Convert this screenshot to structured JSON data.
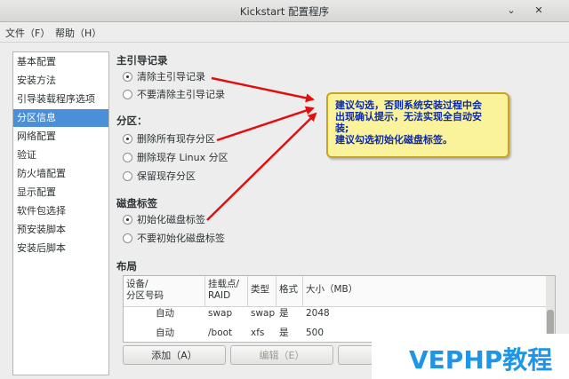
{
  "window": {
    "title": "Kickstart 配置程序",
    "minimize_glyph": "⌄",
    "close_glyph": "✕"
  },
  "menu": {
    "file": "文件（F）",
    "help": "帮助（H）"
  },
  "sidebar": {
    "items": [
      {
        "label": "基本配置"
      },
      {
        "label": "安装方法"
      },
      {
        "label": "引导装载程序选项"
      },
      {
        "label": "分区信息",
        "active": true
      },
      {
        "label": "网络配置"
      },
      {
        "label": "验证"
      },
      {
        "label": "防火墙配置"
      },
      {
        "label": "显示配置"
      },
      {
        "label": "软件包选择"
      },
      {
        "label": "预安装脚本"
      },
      {
        "label": "安装后脚本"
      }
    ]
  },
  "mbr": {
    "title": "主引导记录",
    "options": [
      {
        "label": "清除主引导记录",
        "selected": true
      },
      {
        "label": "不要清除主引导记录",
        "selected": false
      }
    ]
  },
  "partitions": {
    "title": "分区：",
    "options": [
      {
        "label": "删除所有现存分区",
        "selected": true
      },
      {
        "label": "删除现存 Linux 分区",
        "selected": false
      },
      {
        "label": "保留现存分区",
        "selected": false
      }
    ]
  },
  "disk_label": {
    "title": "磁盘标签",
    "options": [
      {
        "label": "初始化磁盘标签",
        "selected": true
      },
      {
        "label": "不要初始化磁盘标签",
        "selected": false
      }
    ]
  },
  "layout": {
    "title": "布局",
    "columns": [
      {
        "line1": "设备/",
        "line2": "分区号码"
      },
      {
        "line1": "挂载点/",
        "line2": "RAID"
      },
      {
        "line1": "类型",
        "line2": ""
      },
      {
        "line1": "格式",
        "line2": ""
      },
      {
        "line1": "大小（MB）",
        "line2": ""
      }
    ],
    "rows": [
      {
        "device": "自动",
        "mount": "swap",
        "type": "swap",
        "format": "是",
        "size": "2048"
      },
      {
        "device": "自动",
        "mount": "/boot",
        "type": "xfs",
        "format": "是",
        "size": "500"
      }
    ],
    "buttons": {
      "add": "添加（A）",
      "edit": "编辑（E）"
    }
  },
  "callout": {
    "lines": [
      "建议勾选，否则系统安装过程中会",
      "出现确认提示，无法实现全自动安",
      "装;",
      "建议勾选初始化磁盘标签。"
    ]
  },
  "watermark": {
    "text": "VEPHP教程"
  },
  "colors": {
    "accent": "#4a90d9",
    "arrow": "#e01010",
    "callout_bg": "#fbf29c",
    "callout_text": "#0b2aa8",
    "watermark": "#1f95e8"
  }
}
